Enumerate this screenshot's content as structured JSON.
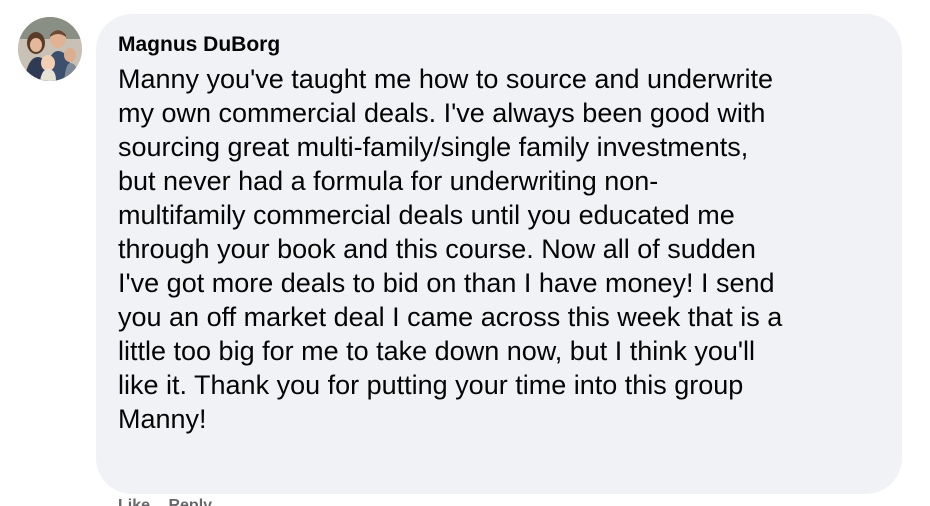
{
  "comment": {
    "author": "Magnus DuBorg",
    "text": "Manny you've taught me how to source and underwrite\nmy own commercial deals. I've always been good with\nsourcing great multi-family/single family investments,\nbut never had a formula for underwriting non-\nmultifamily commercial deals until you educated me\nthrough your book and this course. Now all of sudden\nI've got more deals to bid on than I have money! I send\nyou an off market deal I came across this week that is a\nlittle too big for me to take down now, but I think you'll\nlike it. Thank you for putting your time into this group\nManny!",
    "actions": [
      "Like",
      "Reply"
    ]
  },
  "colors": {
    "bubble": "#f0f2f5",
    "text": "#050505",
    "secondary": "#65676b"
  },
  "icons": [
    "avatar-photo"
  ]
}
